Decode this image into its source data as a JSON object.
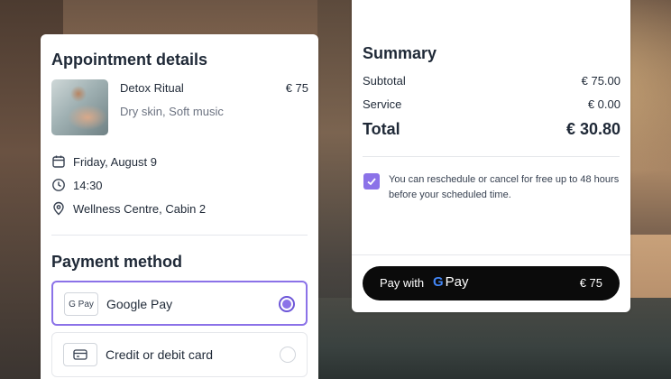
{
  "appointment": {
    "heading": "Appointment details",
    "service_name": "Detox Ritual",
    "service_price": "€ 75",
    "service_details": "Dry skin, Soft music",
    "date": "Friday, August 9",
    "time": "14:30",
    "location": "Wellness Centre, Cabin 2"
  },
  "payment": {
    "heading": "Payment method",
    "options": [
      {
        "logo": "G Pay",
        "label": "Google Pay",
        "selected": true
      },
      {
        "logo": "card-icon",
        "label": "Credit or debit card",
        "selected": false
      }
    ]
  },
  "summary": {
    "heading": "Summary",
    "subtotal_label": "Subtotal",
    "subtotal_value": "€ 75.00",
    "service_label": "Service",
    "service_value": "€ 0.00",
    "total_label": "Total",
    "total_value": "€ 30.80",
    "reschedule_notice": "You can reschedule or cancel for free up to 48 hours before your scheduled time.",
    "notice_checked": true
  },
  "pay_button": {
    "prefix": "Pay with",
    "brand_letter": "G",
    "brand_text": "Pay",
    "amount": "€ 75"
  },
  "colors": {
    "accent": "#8b72e8",
    "button_bg": "#0b0b0b"
  }
}
